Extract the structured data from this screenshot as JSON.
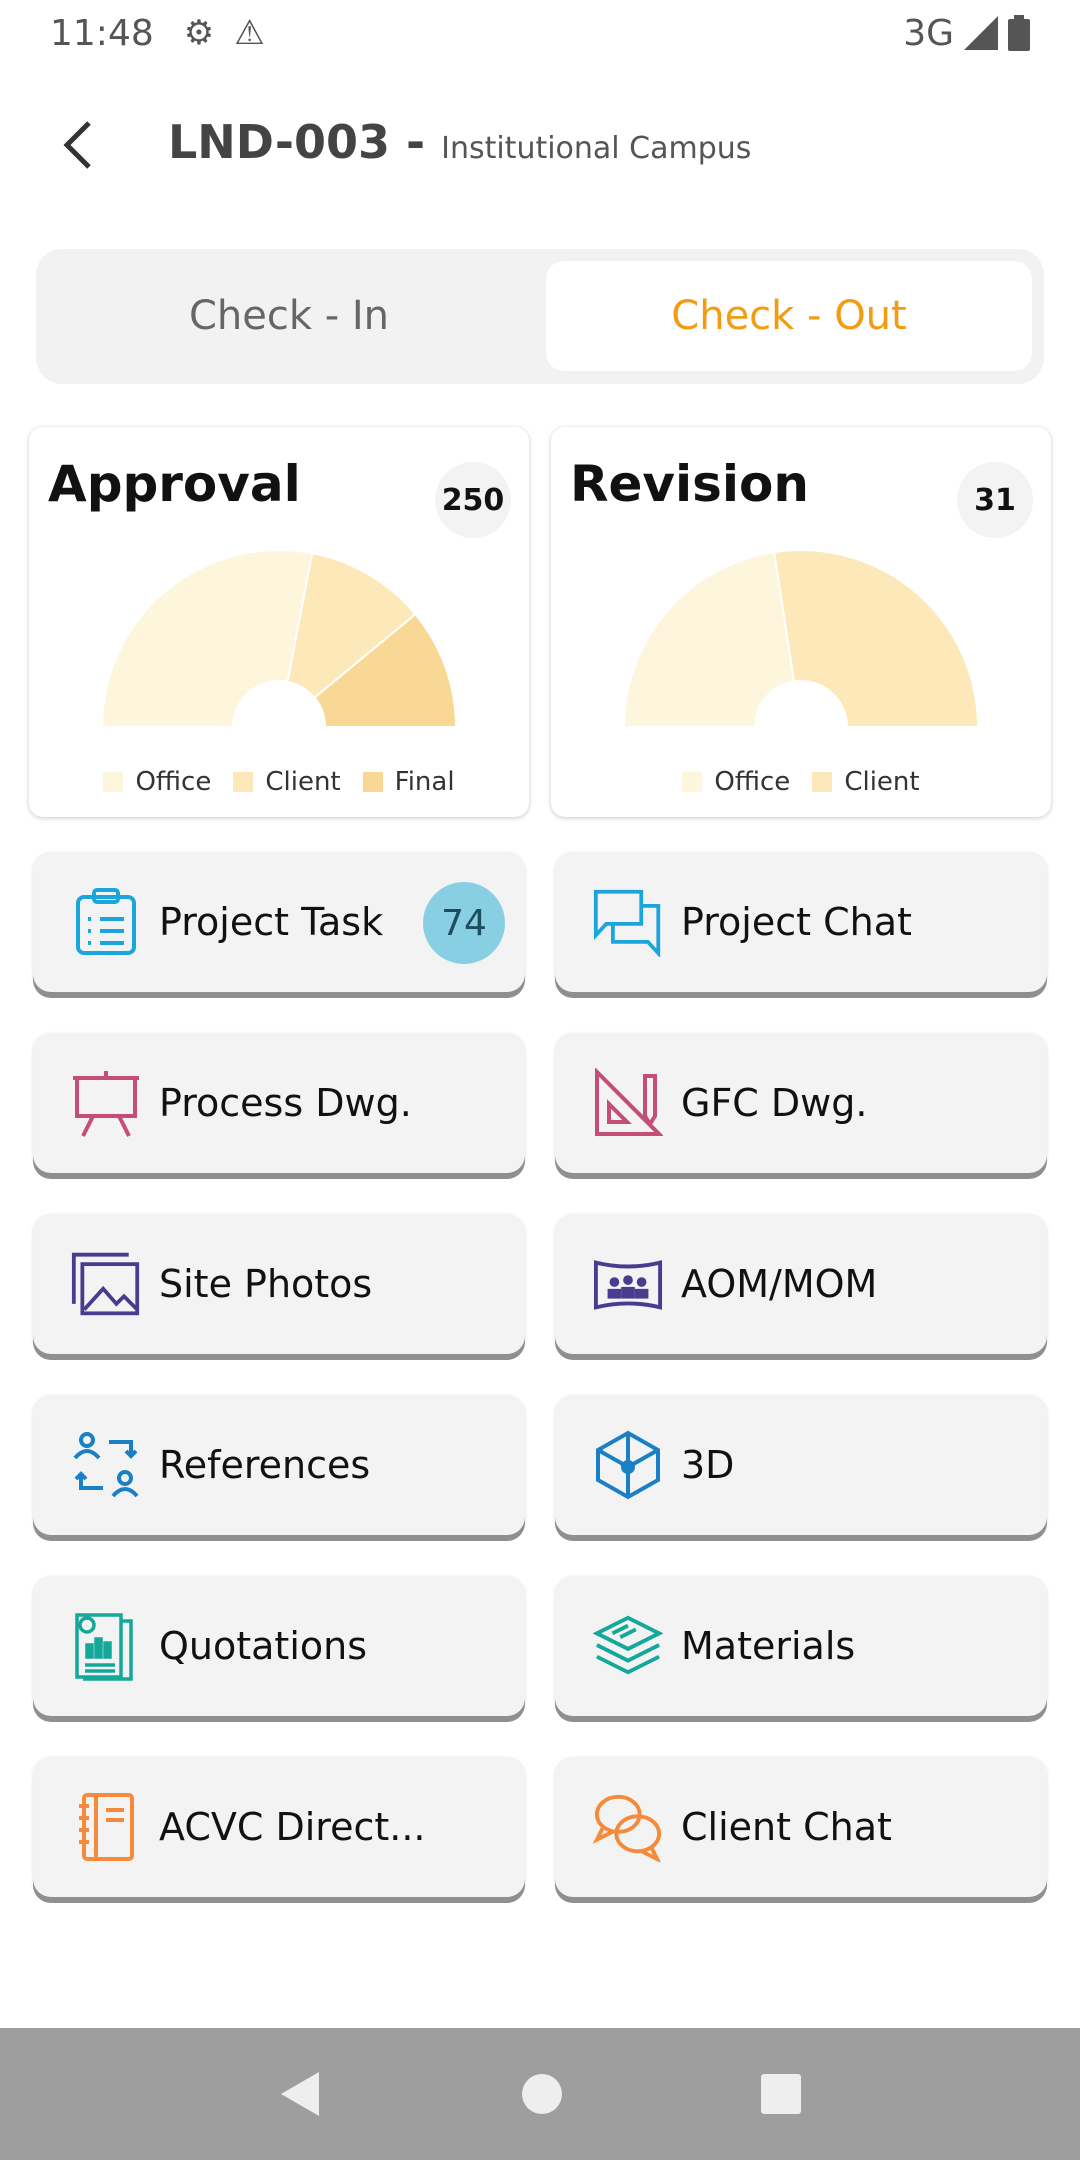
{
  "status_bar": {
    "time": "11:48",
    "network": "3G",
    "icons": [
      "gear-icon",
      "warning-icon",
      "signal-icon",
      "battery-icon"
    ]
  },
  "header": {
    "code": "LND-003 -",
    "subtitle": "Institutional Campus"
  },
  "toggle": {
    "check_in": "Check - In",
    "check_out": "Check - Out",
    "selected": "Check - Out",
    "accent": "#f39c12"
  },
  "cards": [
    {
      "title": "Approval",
      "count": "250"
    },
    {
      "title": "Revision",
      "count": "31"
    }
  ],
  "chart_data": [
    {
      "type": "pie",
      "subtype": "half-donut",
      "title": "Approval",
      "categories": [
        "Office",
        "Client",
        "Final"
      ],
      "values": [
        140,
        55,
        55
      ],
      "colors": [
        "#fdf5dc",
        "#fce8b8",
        "#f9d895"
      ],
      "legend": "bottom"
    },
    {
      "type": "pie",
      "subtype": "half-donut",
      "title": "Revision",
      "categories": [
        "Office",
        "Client"
      ],
      "values": [
        14,
        17
      ],
      "colors": [
        "#fdf5dc",
        "#fce8b8"
      ],
      "legend": "bottom"
    }
  ],
  "tiles": [
    {
      "label": "Project Task",
      "icon": "clipboard-list-icon",
      "badge": "74"
    },
    {
      "label": "Project Chat",
      "icon": "chat-bubbles-icon"
    },
    {
      "label": "Process Dwg.",
      "icon": "easel-icon"
    },
    {
      "label": "GFC Dwg.",
      "icon": "ruler-pencil-icon"
    },
    {
      "label": "Site Photos",
      "icon": "photos-icon"
    },
    {
      "label": "AOM/MOM",
      "icon": "meeting-icon"
    },
    {
      "label": "References",
      "icon": "users-exchange-icon"
    },
    {
      "label": "3D",
      "icon": "cube-icon"
    },
    {
      "label": "Quotations",
      "icon": "quotation-icon"
    },
    {
      "label": "Materials",
      "icon": "layers-icon"
    },
    {
      "label": "ACVC Direct...",
      "icon": "notebook-icon"
    },
    {
      "label": "Client Chat",
      "icon": "chat-icon"
    }
  ]
}
